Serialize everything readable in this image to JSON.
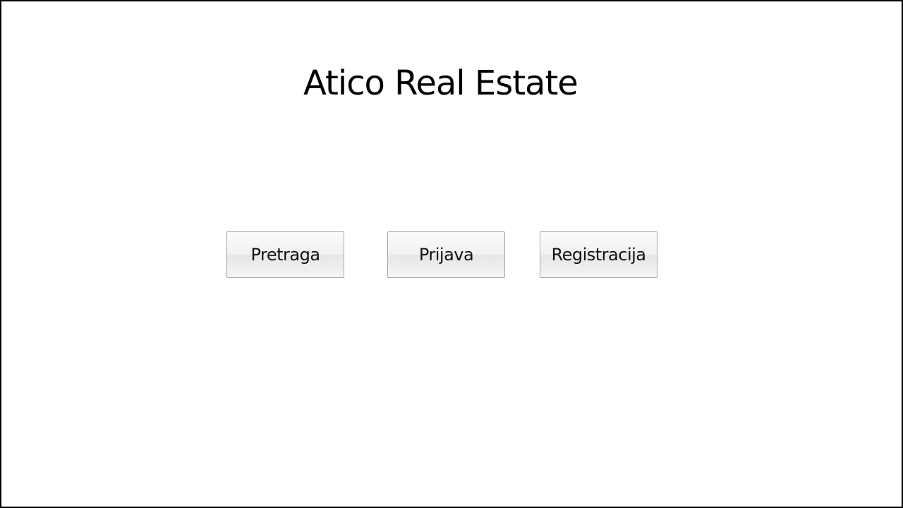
{
  "app": {
    "title": "Atico Real Estate"
  },
  "buttons": {
    "search_label": "Pretraga",
    "login_label": "Prijava",
    "register_label": "Registracija"
  },
  "colors": {
    "background": "#ffffff",
    "border": "#000000",
    "text": "#000000"
  }
}
